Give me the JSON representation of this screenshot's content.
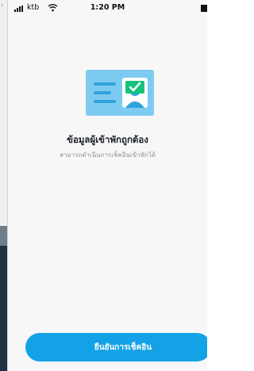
{
  "status_bar": {
    "carrier": "ktb",
    "time": "1:20 PM"
  },
  "illustration": {
    "icon": "id-card-verified-icon",
    "colors": {
      "card": "#7dcbf0",
      "lines": "#2fa3db",
      "check": "#17c27a"
    }
  },
  "main": {
    "title": "ข้อมูลผู้เข้าพักถูกต้อง",
    "subtitle": "สามารถดำเนินการเช็คอินเข้าพักได้"
  },
  "footer": {
    "confirm_label": "ยืนยันการเช็คอิน"
  },
  "colors": {
    "accent": "#14a2e6",
    "background": "#f7f7f8"
  }
}
